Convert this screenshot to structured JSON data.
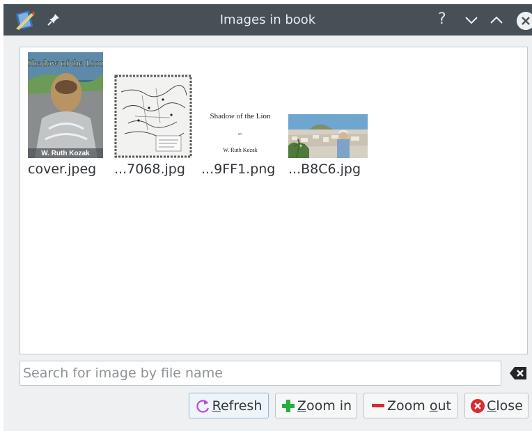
{
  "window": {
    "title": "Images in book",
    "help_glyph": "?"
  },
  "images": [
    {
      "filename": "cover.jpeg",
      "cover_title": "Shadow of the Lion",
      "cover_author": "W. Ruth Kozak"
    },
    {
      "filename": "...7068.jpg"
    },
    {
      "filename": "...9FF1.png",
      "page_title": "Shadow of the Lion",
      "page_by": "BY",
      "page_author": "W. Ruth Kozak"
    },
    {
      "filename": "...B8C6.jpg"
    }
  ],
  "search": {
    "placeholder": "Search for image by file name",
    "value": ""
  },
  "buttons": {
    "refresh": {
      "prefix": "",
      "accel": "R",
      "suffix": "efresh"
    },
    "zoom_in": {
      "prefix": "",
      "accel": "Z",
      "suffix": "oom in"
    },
    "zoom_out": {
      "prefix": "Zoom ",
      "accel": "o",
      "suffix": "ut"
    },
    "close": {
      "prefix": "",
      "accel": "C",
      "suffix": "lose"
    }
  },
  "colors": {
    "titlebar": "#475057",
    "refresh_icon": "#b84ad8",
    "zoom_in_icon": "#27ae3c",
    "zoom_out_icon": "#da2930",
    "close_icon": "#da2930"
  }
}
